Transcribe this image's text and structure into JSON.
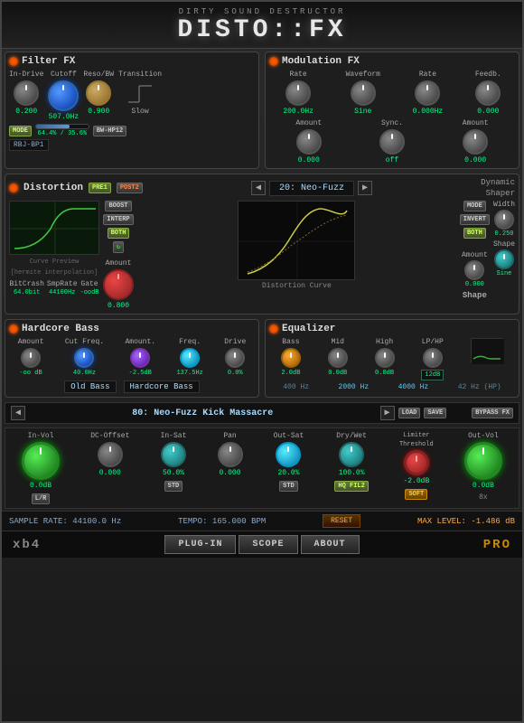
{
  "header": {
    "subtitle": "Dirty Sound Destructor",
    "title": "DISTO::FX"
  },
  "filter_fx": {
    "title": "Filter FX",
    "in_drive_label": "In-Drive",
    "in_drive_value": "0.200",
    "cutoff_label": "Cutoff",
    "cutoff_value": "507.0Hz",
    "reso_label": "Reso/BW",
    "reso_value": "0.900",
    "transition_label": "Transition",
    "transition_value": "Slow",
    "mode_label": "MODE",
    "mode_value": "RBJ-BP1",
    "slider_value": "64.4% / 35.6%",
    "mode2_value": "BW-HP12"
  },
  "modulation_fx": {
    "title": "Modulation FX",
    "rate_label": "Rate",
    "rate_value": "200.0Hz",
    "waveform_label": "Waveform",
    "waveform_value": "Sine",
    "rate2_label": "Rate",
    "rate2_value": "0.000Hz",
    "feedb_label": "Feedb.",
    "feedb_value": "0.000",
    "amount_label": "Amount",
    "amount_value": "0.000",
    "sync_label": "Sync.",
    "sync_value": "off",
    "amount2_label": "Amount",
    "amount2_value": "0.000"
  },
  "distortion": {
    "title": "Distortion",
    "pre_label": "PRE1",
    "post_label": "POST2",
    "dynamic_shaper_label": "Dynamic",
    "dynamic_shaper_label2": "Shaper",
    "preset_name": "20: Neo-Fuzz",
    "boost_label": "BOOST",
    "interp_label": "INTERP",
    "both_label": "BOTH",
    "refresh_label": "C",
    "amount_label": "Amount",
    "amount_value": "0.800",
    "mode_label": "MODE",
    "invert_label": "INVERT",
    "both2_label": "BOTH",
    "dist_amount_label": "Amount",
    "dist_amount_value": "0.000",
    "dist_curve_label": "Distortion Curve",
    "width_label": "Width",
    "width_value": "0.250",
    "shape_label": "Shape",
    "shape_value": "Sine",
    "bitcrash_label": "BitCrash",
    "bitcrash_value": "64.0bit",
    "smprate_label": "SmpRate",
    "smprate_value": "44100Hz",
    "gate_label": "Gate",
    "gate_value": "-oodB"
  },
  "hardcore_bass": {
    "title": "Hardcore Bass",
    "amount_label": "Amount",
    "amount_value": "-oo dB",
    "cut_freq_label": "Cut Freq.",
    "cut_freq_value": "40.0Hz",
    "amount2_label": "Amount.",
    "amount2_value": "-2.5dB",
    "freq_label": "Freq.",
    "freq_value": "137.5Hz",
    "drive_label": "Drive",
    "drive_value": "0.0%",
    "preset1": "Old Bass",
    "preset2": "Hardcore Bass"
  },
  "equalizer": {
    "title": "Equalizer",
    "bass_label": "Bass",
    "bass_value": "2.0dB",
    "mid_label": "Mid",
    "mid_value": "0.0dB",
    "high_label": "High",
    "high_value": "0.0dB",
    "lphp_label": "LP/HP",
    "lphp_value": "12dB",
    "freq1": "400 Hz",
    "freq2": "2000 Hz",
    "freq3": "4000 Hz",
    "freq4": "42 Hz (HP)"
  },
  "preset_bar": {
    "preset_name": "80: Neo-Fuzz Kick Massacre",
    "load_label": "LOAD",
    "save_label": "SAVE",
    "bypass_label": "BYPASS FX"
  },
  "main_controls": {
    "invol_label": "In-Vol",
    "invol_value": "0.0dB",
    "lr_label": "L/R",
    "dcoffset_label": "DC-Offset",
    "dcoffset_value": "0.000",
    "insat_label": "In-Sat",
    "insat_value": "50.0%",
    "std_label": "STD",
    "pan_label": "Pan",
    "pan_value": "0.000",
    "outsat_label": "Out-Sat",
    "outsat_value": "20.0%",
    "std2_label": "STD",
    "drywet_label": "Dry/Wet",
    "drywet_value": "100.0%",
    "hqfil2_label": "HQ FIL2",
    "limiter_label": "Limiter",
    "threshold_label": "Threshold",
    "threshold_value": "-2.0dB",
    "soft_label": "SOFT",
    "outvol_label": "Out-Vol",
    "outvol_value": "0.0dB",
    "x8_label": "8x"
  },
  "status_bar": {
    "sample_rate": "SAMPLE RATE: 44100.0 Hz",
    "tempo": "TEMPO: 165.000 BPM",
    "reset_label": "RESET",
    "max_level": "MAX LEVEL: -1.486 dB"
  },
  "bottom_tabs": {
    "brand_left": "xb4",
    "plugin_label": "PLUG-IN",
    "scope_label": "SCOPE",
    "about_label": "ABOUT",
    "brand_right": "PRO"
  }
}
